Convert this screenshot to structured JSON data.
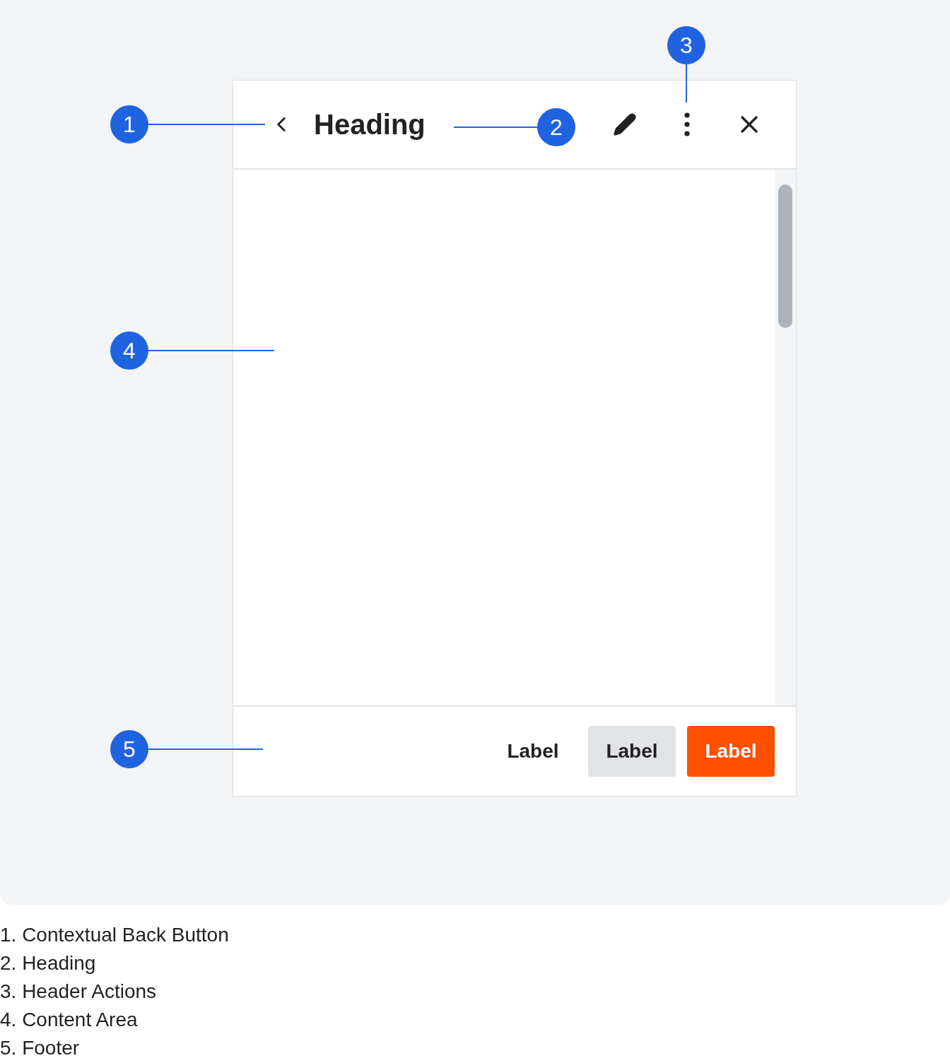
{
  "panel": {
    "heading": "Heading",
    "footer_buttons": [
      {
        "kind": "text",
        "label": "Label"
      },
      {
        "kind": "secondary",
        "label": "Label"
      },
      {
        "kind": "primary",
        "label": "Label"
      }
    ]
  },
  "callouts": [
    "1",
    "2",
    "3",
    "4",
    "5"
  ],
  "legend": [
    "1. Contextual Back Button",
    "2. Heading",
    "3. Header Actions",
    "4. Content Area",
    "5. Footer"
  ]
}
